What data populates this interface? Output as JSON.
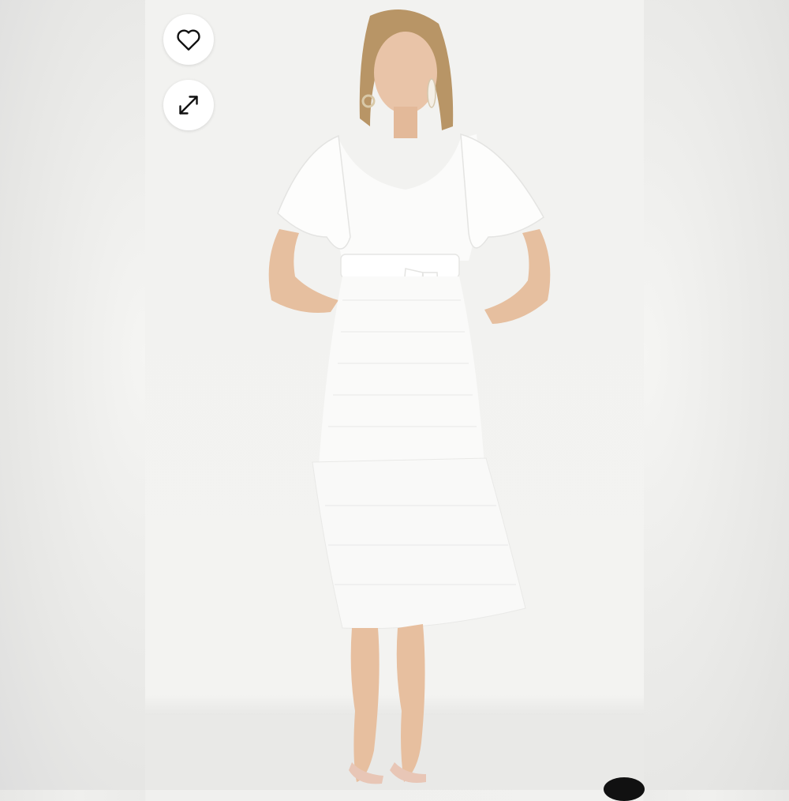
{
  "gallery": {
    "favorite_button": {
      "icon": "heart-icon"
    },
    "expand_button": {
      "icon": "expand-arrows-icon"
    },
    "photo": {
      "subject": "product-image"
    }
  },
  "colors": {
    "button_bg": "#ffffff",
    "icon": "#111111",
    "backdrop": "#f2f2f0"
  }
}
